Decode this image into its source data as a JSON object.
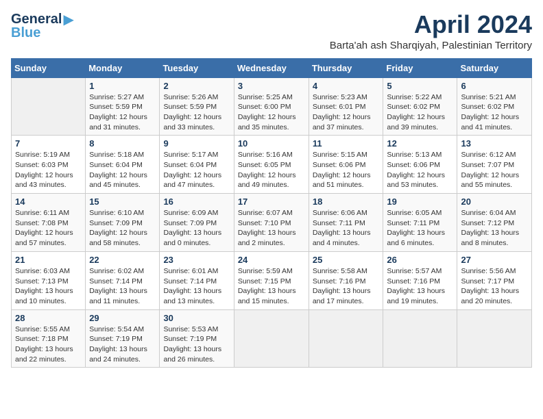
{
  "logo": {
    "line1": "General",
    "line2": "Blue",
    "icon": "🔷"
  },
  "title": "April 2024",
  "location": "Barta'ah ash Sharqiyah, Palestinian Territory",
  "weekdays": [
    "Sunday",
    "Monday",
    "Tuesday",
    "Wednesday",
    "Thursday",
    "Friday",
    "Saturday"
  ],
  "weeks": [
    [
      {
        "day": "",
        "info": ""
      },
      {
        "day": "1",
        "info": "Sunrise: 5:27 AM\nSunset: 5:59 PM\nDaylight: 12 hours\nand 31 minutes."
      },
      {
        "day": "2",
        "info": "Sunrise: 5:26 AM\nSunset: 5:59 PM\nDaylight: 12 hours\nand 33 minutes."
      },
      {
        "day": "3",
        "info": "Sunrise: 5:25 AM\nSunset: 6:00 PM\nDaylight: 12 hours\nand 35 minutes."
      },
      {
        "day": "4",
        "info": "Sunrise: 5:23 AM\nSunset: 6:01 PM\nDaylight: 12 hours\nand 37 minutes."
      },
      {
        "day": "5",
        "info": "Sunrise: 5:22 AM\nSunset: 6:02 PM\nDaylight: 12 hours\nand 39 minutes."
      },
      {
        "day": "6",
        "info": "Sunrise: 5:21 AM\nSunset: 6:02 PM\nDaylight: 12 hours\nand 41 minutes."
      }
    ],
    [
      {
        "day": "7",
        "info": "Sunrise: 5:19 AM\nSunset: 6:03 PM\nDaylight: 12 hours\nand 43 minutes."
      },
      {
        "day": "8",
        "info": "Sunrise: 5:18 AM\nSunset: 6:04 PM\nDaylight: 12 hours\nand 45 minutes."
      },
      {
        "day": "9",
        "info": "Sunrise: 5:17 AM\nSunset: 6:04 PM\nDaylight: 12 hours\nand 47 minutes."
      },
      {
        "day": "10",
        "info": "Sunrise: 5:16 AM\nSunset: 6:05 PM\nDaylight: 12 hours\nand 49 minutes."
      },
      {
        "day": "11",
        "info": "Sunrise: 5:15 AM\nSunset: 6:06 PM\nDaylight: 12 hours\nand 51 minutes."
      },
      {
        "day": "12",
        "info": "Sunrise: 5:13 AM\nSunset: 6:06 PM\nDaylight: 12 hours\nand 53 minutes."
      },
      {
        "day": "13",
        "info": "Sunrise: 6:12 AM\nSunset: 7:07 PM\nDaylight: 12 hours\nand 55 minutes."
      }
    ],
    [
      {
        "day": "14",
        "info": "Sunrise: 6:11 AM\nSunset: 7:08 PM\nDaylight: 12 hours\nand 57 minutes."
      },
      {
        "day": "15",
        "info": "Sunrise: 6:10 AM\nSunset: 7:09 PM\nDaylight: 12 hours\nand 58 minutes."
      },
      {
        "day": "16",
        "info": "Sunrise: 6:09 AM\nSunset: 7:09 PM\nDaylight: 13 hours\nand 0 minutes."
      },
      {
        "day": "17",
        "info": "Sunrise: 6:07 AM\nSunset: 7:10 PM\nDaylight: 13 hours\nand 2 minutes."
      },
      {
        "day": "18",
        "info": "Sunrise: 6:06 AM\nSunset: 7:11 PM\nDaylight: 13 hours\nand 4 minutes."
      },
      {
        "day": "19",
        "info": "Sunrise: 6:05 AM\nSunset: 7:11 PM\nDaylight: 13 hours\nand 6 minutes."
      },
      {
        "day": "20",
        "info": "Sunrise: 6:04 AM\nSunset: 7:12 PM\nDaylight: 13 hours\nand 8 minutes."
      }
    ],
    [
      {
        "day": "21",
        "info": "Sunrise: 6:03 AM\nSunset: 7:13 PM\nDaylight: 13 hours\nand 10 minutes."
      },
      {
        "day": "22",
        "info": "Sunrise: 6:02 AM\nSunset: 7:14 PM\nDaylight: 13 hours\nand 11 minutes."
      },
      {
        "day": "23",
        "info": "Sunrise: 6:01 AM\nSunset: 7:14 PM\nDaylight: 13 hours\nand 13 minutes."
      },
      {
        "day": "24",
        "info": "Sunrise: 5:59 AM\nSunset: 7:15 PM\nDaylight: 13 hours\nand 15 minutes."
      },
      {
        "day": "25",
        "info": "Sunrise: 5:58 AM\nSunset: 7:16 PM\nDaylight: 13 hours\nand 17 minutes."
      },
      {
        "day": "26",
        "info": "Sunrise: 5:57 AM\nSunset: 7:16 PM\nDaylight: 13 hours\nand 19 minutes."
      },
      {
        "day": "27",
        "info": "Sunrise: 5:56 AM\nSunset: 7:17 PM\nDaylight: 13 hours\nand 20 minutes."
      }
    ],
    [
      {
        "day": "28",
        "info": "Sunrise: 5:55 AM\nSunset: 7:18 PM\nDaylight: 13 hours\nand 22 minutes."
      },
      {
        "day": "29",
        "info": "Sunrise: 5:54 AM\nSunset: 7:19 PM\nDaylight: 13 hours\nand 24 minutes."
      },
      {
        "day": "30",
        "info": "Sunrise: 5:53 AM\nSunset: 7:19 PM\nDaylight: 13 hours\nand 26 minutes."
      },
      {
        "day": "",
        "info": ""
      },
      {
        "day": "",
        "info": ""
      },
      {
        "day": "",
        "info": ""
      },
      {
        "day": "",
        "info": ""
      }
    ]
  ]
}
